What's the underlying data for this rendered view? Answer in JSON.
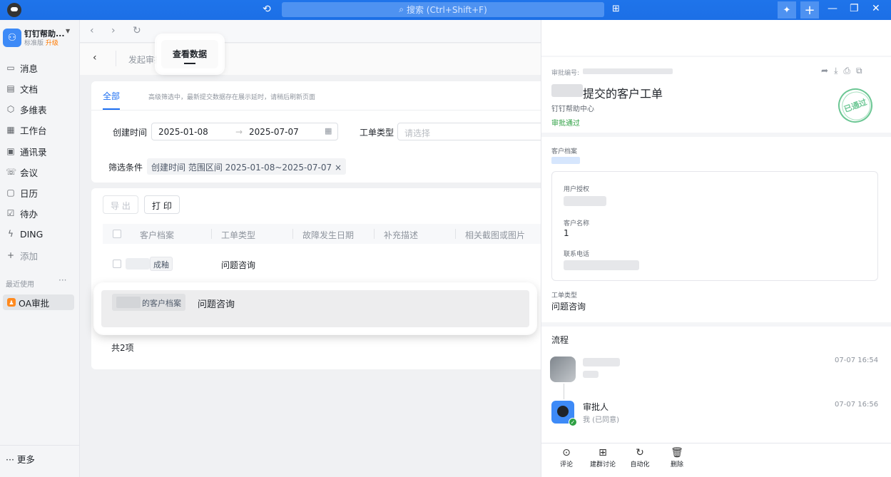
{
  "titlebar": {
    "search_placeholder": "搜索 (Ctrl+Shift+F)",
    "icons": [
      "history-icon",
      "search-icon",
      "grid-add-icon",
      "magic-wand-icon",
      "plus-icon",
      "minimize-icon",
      "restore-icon",
      "close-icon"
    ]
  },
  "sidebar": {
    "org_name": "钉钉帮助...",
    "org_edition": "标准版",
    "org_upgrade": "升级",
    "items": [
      {
        "label": "消息",
        "icon": "message-icon"
      },
      {
        "label": "文档",
        "icon": "document-icon"
      },
      {
        "label": "多维表",
        "icon": "cube-icon"
      },
      {
        "label": "工作台",
        "icon": "workbench-icon"
      },
      {
        "label": "通讯录",
        "icon": "contacts-icon"
      },
      {
        "label": "会议",
        "icon": "meeting-icon"
      },
      {
        "label": "日历",
        "icon": "calendar-icon"
      },
      {
        "label": "待办",
        "icon": "todo-icon"
      },
      {
        "label": "DING",
        "icon": "lightning-icon"
      },
      {
        "label": "添加",
        "icon": "plus-icon"
      }
    ],
    "recent_label": "最近使用",
    "recent_app": "OA审批",
    "more_label": "更多"
  },
  "main": {
    "header": {
      "tab_launch": "发起审批",
      "tab_view_data": "查看数据"
    },
    "filter": {
      "tab_all": "全部",
      "hint": "高级筛选中，最新提交数据存在展示延时，请稍后刷新页面",
      "created_label": "创建时间",
      "date_start": "2025-01-08",
      "date_end": "2025-07-07",
      "type_label": "工单类型",
      "type_placeholder": "请选择",
      "conditions_label": "筛选条件",
      "chip": "创建时间 范围区间 2025-01-08~2025-07-07 ×"
    },
    "table": {
      "export_label": "导 出",
      "print_label": "打 印",
      "columns": [
        "客户档案",
        "工单类型",
        "故障发生日期",
        "补充描述",
        "相关截图或图片"
      ],
      "rows": [
        {
          "customer_tag": "成釉",
          "type": "问题咨询"
        },
        {
          "customer_tag": "的客户档案",
          "type": "问题咨询"
        }
      ],
      "total": "共2项"
    }
  },
  "panel": {
    "no_label": "审批编号:",
    "title": "提交的客户工单",
    "org": "钉钉帮助中心",
    "status": "审批通过",
    "stamp": "已通过",
    "customer_file_label": "客户档案",
    "user_auth_label": "用户授权",
    "customer_name_label": "客户名称",
    "customer_name_value": "1",
    "phone_label": "联系电话",
    "type_label": "工单类型",
    "type_value": "问题咨询",
    "flow_label": "流程",
    "flow": [
      {
        "time": "07-07 16:54"
      },
      {
        "name": "审批人",
        "sub": "我 (已同意)",
        "time": "07-07 16:56"
      }
    ],
    "actions": [
      {
        "label": "评论",
        "icon": "comment-icon"
      },
      {
        "label": "建群讨论",
        "icon": "group-chat-icon"
      },
      {
        "label": "自动化",
        "icon": "automation-icon"
      },
      {
        "label": "删除",
        "icon": "delete-icon"
      }
    ]
  }
}
